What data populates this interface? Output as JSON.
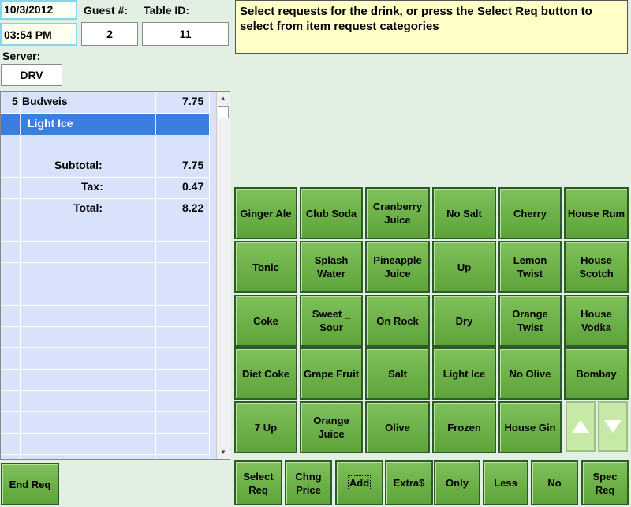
{
  "header": {
    "date": "10/3/2012",
    "time": "03:54 PM",
    "guest_label": "Guest #:",
    "guest_value": "2",
    "table_label": "Table ID:",
    "table_value": "11",
    "server_label": "Server:",
    "server_value": "DRV"
  },
  "message": "Select requests for the drink, or press the Select Req button to select from item request categories",
  "ticket": {
    "item_qty": "5",
    "item_name": "Budweis",
    "item_price": "7.75",
    "selected_line": "Light Ice",
    "subtotal_label": "Subtotal:",
    "subtotal": "7.75",
    "tax_label": "Tax:",
    "tax": "0.47",
    "total_label": "Total:",
    "total": "8.22"
  },
  "grid": [
    [
      "Ginger Ale",
      "Club Soda",
      "Cranberry Juice",
      "No Salt",
      "Cherry",
      "House Rum"
    ],
    [
      "Tonic",
      "Splash Water",
      "Pineapple Juice",
      "Up",
      "Lemon Twist",
      "House Scotch"
    ],
    [
      "Coke",
      "Sweet _ Sour",
      "On Rock",
      "Dry",
      "Orange Twist",
      "House Vodka"
    ],
    [
      "Diet Coke",
      "Grape Fruit",
      "Salt",
      "Light Ice",
      "No Olive",
      "Bombay"
    ],
    [
      "7 Up",
      "Orange Juice",
      "Olive",
      "Frozen",
      "House Gin"
    ]
  ],
  "bottom": {
    "end_req": "End Req",
    "select_req": "Select Req",
    "chng_price": "Chng Price",
    "add": "Add",
    "extra": "Extra$",
    "only": "Only",
    "less": "Less",
    "no": "No",
    "spec_req": "Spec Req"
  },
  "icons": {
    "up": "arrow-up-icon",
    "down": "arrow-down-icon"
  },
  "colors": {
    "button": "#6cb048",
    "ticket": "#d8e3fb",
    "selected": "#3a7fe0",
    "message": "#ffffc8"
  }
}
